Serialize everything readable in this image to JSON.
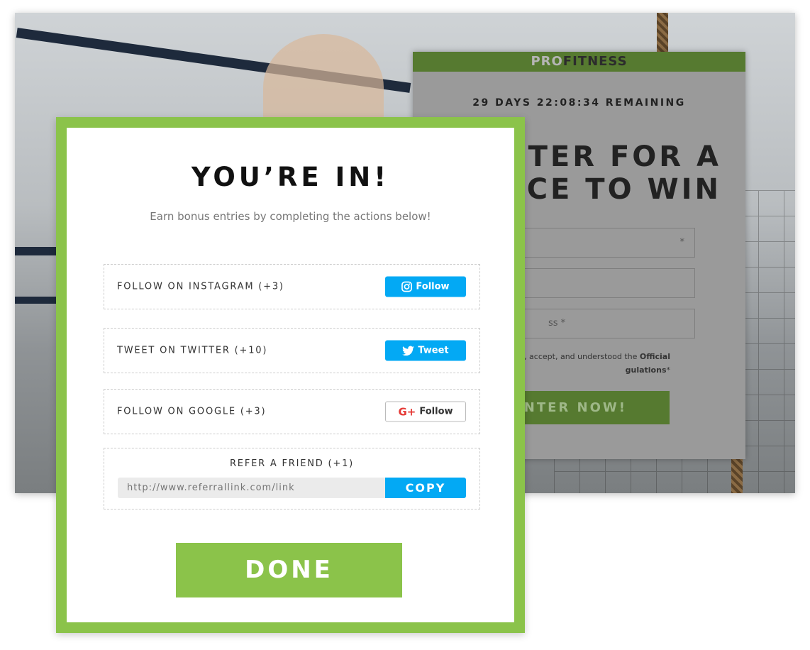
{
  "colors": {
    "accent_green": "#8bc34a",
    "brand_green_dim": "#567a30",
    "button_blue": "#03a9f4",
    "google_red": "#e53935"
  },
  "background_card": {
    "brand_pro": "PRO",
    "brand_fitness": "FITNESS",
    "countdown": "29 DAYS 22:08:34 REMAINING",
    "headline_line1": "ENTER FOR A",
    "headline_line2": "CHANCE TO WIN",
    "field1_placeholder": "*",
    "field2_placeholder": "",
    "field3_placeholder": "ss *",
    "consent_text": ", accept, and understood the ",
    "consent_bold1": "Official",
    "consent_bold2": "gulations",
    "consent_suffix": "*",
    "enter_button": "ENTER NOW!"
  },
  "modal": {
    "title": "YOU’RE IN!",
    "subtitle": "Earn bonus entries by completing the actions below!",
    "actions": [
      {
        "label": "FOLLOW ON INSTAGRAM (+3)",
        "button": "Follow",
        "icon": "instagram-icon"
      },
      {
        "label": "TWEET ON TWITTER (+10)",
        "button": "Tweet",
        "icon": "twitter-icon"
      },
      {
        "label": "FOLLOW ON GOOGLE  (+3)",
        "button": "Follow",
        "icon": "google-plus-icon",
        "icon_text": "G+"
      }
    ],
    "refer": {
      "label": "REFER A FRIEND (+1)",
      "link_placeholder": "http://www.referrallink.com/link",
      "copy_button": "COPY"
    },
    "done_button": "DONE"
  }
}
